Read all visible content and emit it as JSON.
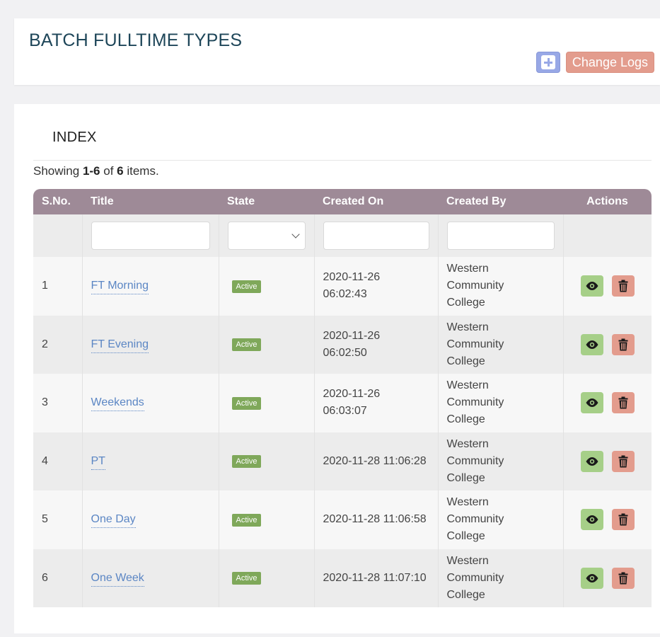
{
  "header": {
    "title": "BATCH FULLTIME TYPES",
    "change_logs_label": "Change Logs"
  },
  "index": {
    "title": "INDEX",
    "summary": {
      "prefix": "Showing ",
      "range": "1-6",
      "middle": " of ",
      "total": "6",
      "suffix": " items."
    }
  },
  "table": {
    "columns": [
      "S.No.",
      "Title",
      "State",
      "Created On",
      "Created By",
      "Actions"
    ],
    "rows": [
      {
        "sno": "1",
        "title": "FT Morning",
        "state": "Active",
        "created_on_line1": "2020-11-26",
        "created_on_line2": "06:02:43",
        "created_by": [
          "Western",
          "Community",
          "College"
        ]
      },
      {
        "sno": "2",
        "title": "FT Evening",
        "state": "Active",
        "created_on_line1": "2020-11-26",
        "created_on_line2": "06:02:50",
        "created_by": [
          "Western",
          "Community",
          "College"
        ]
      },
      {
        "sno": "3",
        "title": "Weekends",
        "state": "Active",
        "created_on_line1": "2020-11-26",
        "created_on_line2": "06:03:07",
        "created_by": [
          "Western",
          "Community",
          "College"
        ]
      },
      {
        "sno": "4",
        "title": "PT",
        "state": "Active",
        "created_on_line1": "2020-11-28 11:06:28",
        "created_on_line2": "",
        "created_by": [
          "Western",
          "Community",
          "College"
        ]
      },
      {
        "sno": "5",
        "title": "One Day",
        "state": "Active",
        "created_on_line1": "2020-11-28 11:06:58",
        "created_on_line2": "",
        "created_by": [
          "Western",
          "Community",
          "College"
        ]
      },
      {
        "sno": "6",
        "title": "One Week",
        "state": "Active",
        "created_on_line1": "2020-11-28 11:07:10",
        "created_on_line2": "",
        "created_by": [
          "Western",
          "Community",
          "College"
        ]
      }
    ]
  },
  "icons": {
    "add": "plus-square-icon",
    "view": "eye-icon",
    "delete": "trash-icon",
    "select": "chevron-down-icon"
  },
  "colors": {
    "title": "#1e4659",
    "header_bg": "#9e8a97",
    "link": "#5b86c4",
    "active_badge": "#7fa85a",
    "view_button": "#a6cf88",
    "delete_button": "#e39c8d",
    "add_button": "#98a8e6"
  }
}
